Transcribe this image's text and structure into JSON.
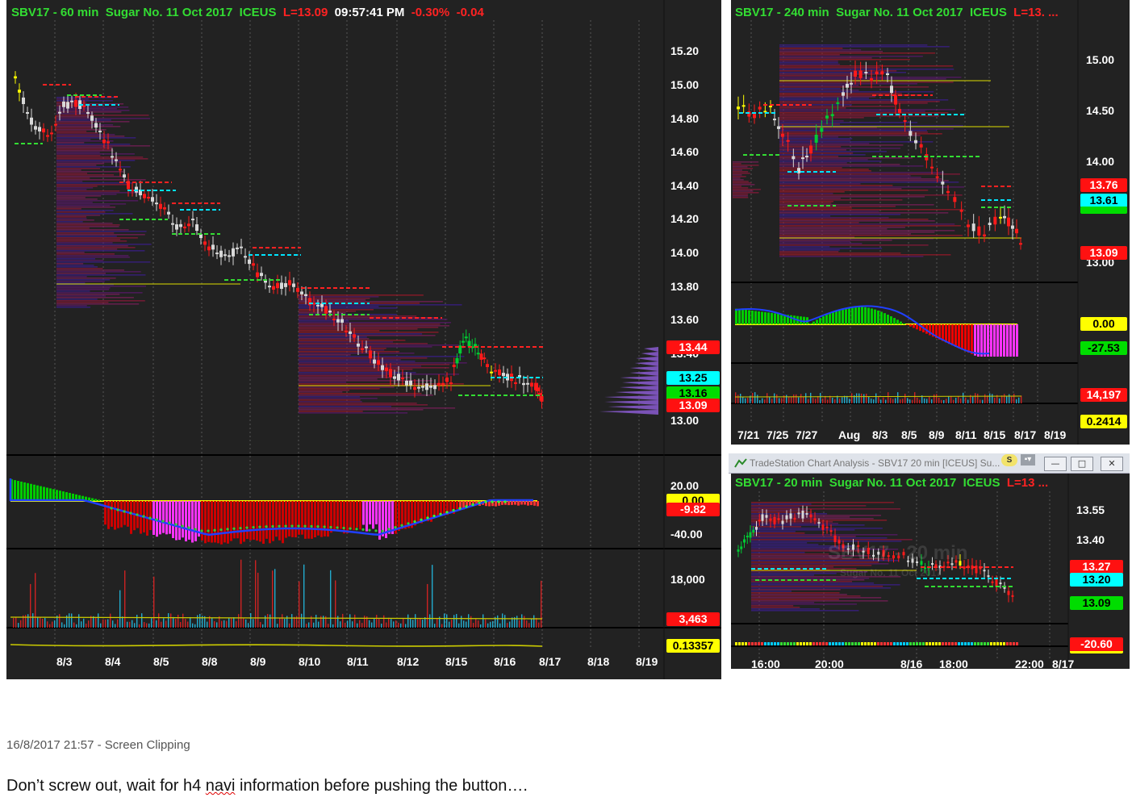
{
  "chart_main": {
    "title": {
      "symbol": "SBV17 - 60 min",
      "instrument": "Sugar No. 11 Oct 2017",
      "exchange": "ICEUS",
      "last": "L=13.09",
      "time": "09:57:41 PM",
      "pct": "-0.30%",
      "chg": "-0.04"
    },
    "y_ticks": [
      "15.20",
      "15.00",
      "14.80",
      "14.60",
      "14.40",
      "14.20",
      "14.00",
      "13.80",
      "13.60",
      "13.40",
      "13.00"
    ],
    "price_tags": {
      "t1": "13.44",
      "t2": "13.25",
      "t3": "13.16",
      "t4": "13.09"
    },
    "osc_ticks": [
      "20.00",
      "-40.00"
    ],
    "osc_tags": {
      "t1": "0.00",
      "t2": "-9.82"
    },
    "vol_tick": "18,000",
    "vol_tag": "3,463",
    "ind_tag": "0.13357",
    "x_labels": [
      "8/3",
      "8/4",
      "8/5",
      "8/8",
      "8/9",
      "8/10",
      "8/11",
      "8/12",
      "8/15",
      "8/16",
      "8/17",
      "8/18",
      "8/19"
    ]
  },
  "chart_240": {
    "title": {
      "symbol": "SBV17 - 240 min",
      "instrument": "Sugar No. 11 Oct 2017",
      "exchange": "ICEUS",
      "last": "L=13. ..."
    },
    "y_ticks": [
      "15.00",
      "14.50",
      "14.00",
      "13.00"
    ],
    "price_tags": {
      "t1": "13.76",
      "t2": "13.61",
      "t3": "13.09"
    },
    "osc_tags": {
      "t1": "0.00",
      "t2": "-27.53"
    },
    "vol_tag": "14,197",
    "ind_tag": "0.2414",
    "x_labels": [
      "7/21",
      "7/25",
      "7/27",
      "Aug",
      "8/3",
      "8/5",
      "8/9",
      "8/11",
      "8/15",
      "8/17",
      "8/19"
    ]
  },
  "window": {
    "title": "TradeStation Chart Analysis - SBV17 20 min [ICEUS] Su...",
    "btn_s": "S",
    "btn_min": "—",
    "btn_max": "□",
    "btn_close": "✕"
  },
  "chart_20": {
    "title": {
      "symbol": "SBV17 - 20 min",
      "instrument": "Sugar No. 11 Oct 2017",
      "exchange": "ICEUS",
      "last": "L=13 ..."
    },
    "y_ticks": [
      "13.55",
      "13.40"
    ],
    "price_tags": {
      "t1": "13.27",
      "t2": "13.20",
      "t3": "13.09"
    },
    "osc_tag": "-20.60",
    "watermark": "SBV17 - 20 min",
    "watermark2": "Sugar No. 11 Oct 2017",
    "x_labels": [
      "16:00",
      "20:00",
      "8/16",
      "18:00",
      "22:00",
      "8/17"
    ]
  },
  "caption": "16/8/2017 21:57 - Screen Clipping",
  "note": {
    "before": "Don’t screw out, wait for h4 ",
    "word": "navi",
    "after": " information before pushing the button…."
  },
  "colors": {
    "up": "#00cc00",
    "down": "#ff1a1a",
    "neutral": "#d9d9d9",
    "profile": "#7a1f7a",
    "yellow": "#ffff00",
    "cyan": "#00e5ff",
    "bg": "#222222"
  }
}
